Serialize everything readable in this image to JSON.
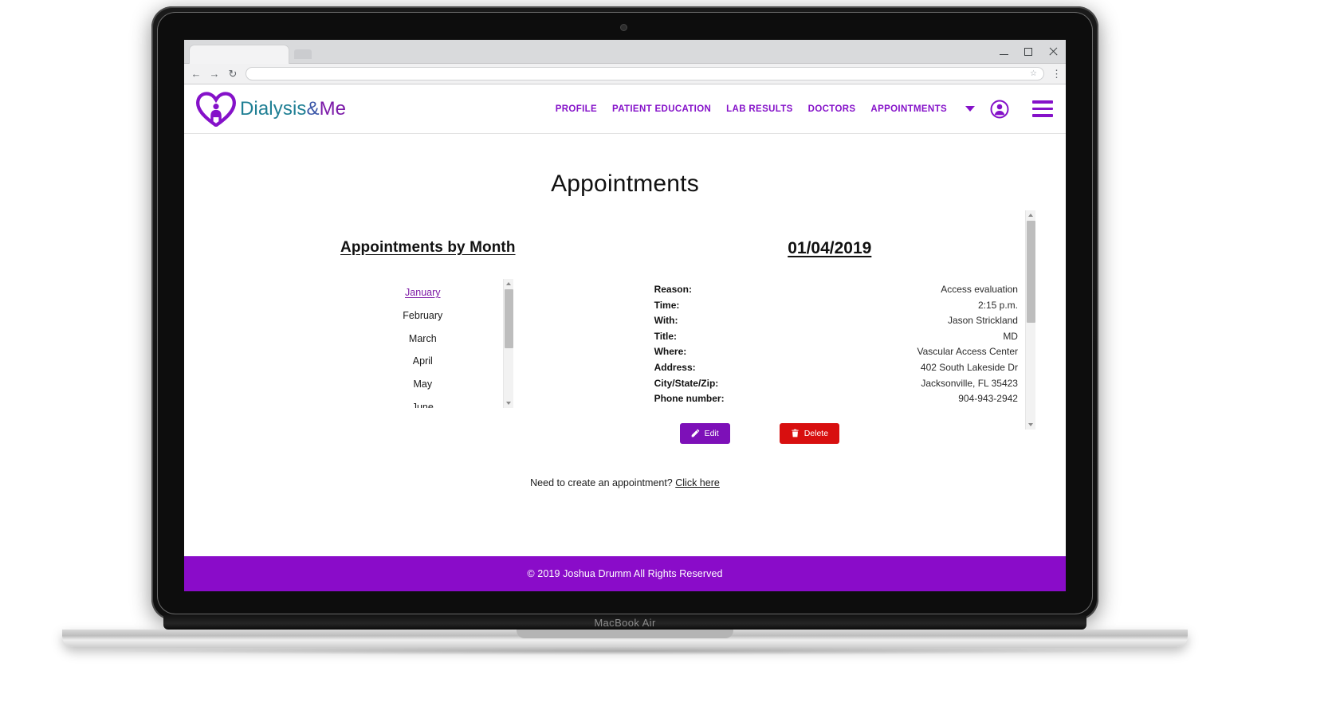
{
  "browser": {
    "url_value": "",
    "url_placeholder": "",
    "window_controls": [
      "minimize",
      "maximize",
      "close"
    ]
  },
  "header": {
    "brand_part1": "Dialysis",
    "brand_part2": "&",
    "brand_part3": "Me",
    "nav": [
      {
        "label": "PROFILE"
      },
      {
        "label": "PATIENT EDUCATION"
      },
      {
        "label": "LAB RESULTS"
      },
      {
        "label": "DOCTORS"
      },
      {
        "label": "APPOINTMENTS"
      }
    ],
    "accent_color": "#8511c9"
  },
  "main": {
    "page_title": "Appointments",
    "months_section_title": "Appointments by Month",
    "months": [
      {
        "label": "January",
        "active": true
      },
      {
        "label": "February",
        "active": false
      },
      {
        "label": "March",
        "active": false
      },
      {
        "label": "April",
        "active": false
      },
      {
        "label": "May",
        "active": false
      },
      {
        "label": "June",
        "active": false
      }
    ],
    "appointment": {
      "date_title": "01/04/2019",
      "rows": [
        {
          "label": "Reason:",
          "value": "Access evaluation"
        },
        {
          "label": "Time:",
          "value": "2:15 p.m."
        },
        {
          "label": "With:",
          "value": "Jason Strickland"
        },
        {
          "label": "Title:",
          "value": "MD"
        },
        {
          "label": "Where:",
          "value": "Vascular Access Center"
        },
        {
          "label": "Address:",
          "value": "402 South Lakeside Dr"
        },
        {
          "label": "City/State/Zip:",
          "value": "Jacksonville, FL 35423"
        },
        {
          "label": "Phone number:",
          "value": "904-943-2942"
        }
      ],
      "edit_label": "Edit",
      "delete_label": "Delete",
      "edit_color": "#7d10b8",
      "delete_color": "#d80f0f"
    },
    "create_prompt": "Need to create an appointment?",
    "create_link": "Click here"
  },
  "footer": {
    "text": "© 2019 Joshua Drumm All Rights Reserved",
    "background": "#8a0cc9"
  },
  "device": {
    "model_label": "MacBook Air"
  }
}
